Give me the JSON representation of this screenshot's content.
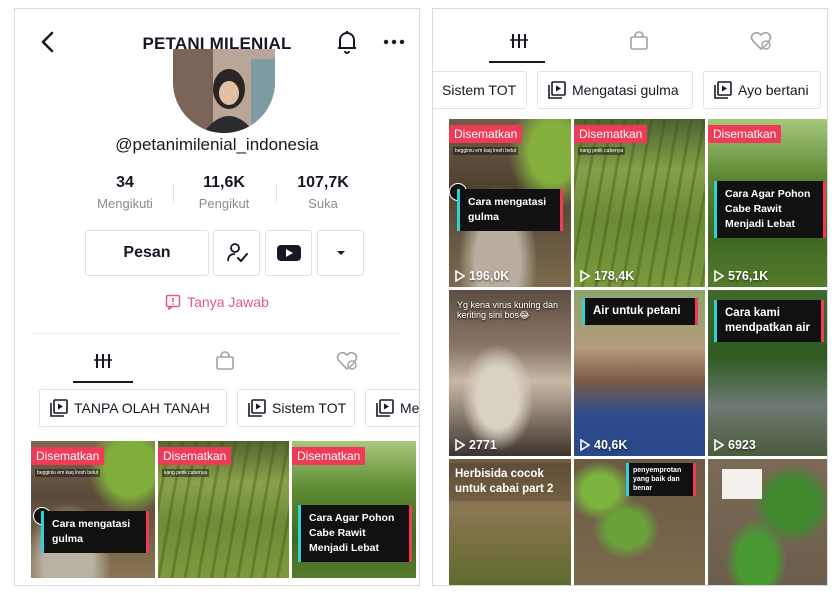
{
  "header": {
    "title": "PETANI MILENIAL"
  },
  "profile": {
    "username": "@petanimilenial_indonesia",
    "stats": [
      {
        "value": "34",
        "label": "Mengikuti"
      },
      {
        "value": "11,6K",
        "label": "Pengikut"
      },
      {
        "value": "107,7K",
        "label": "Suka"
      }
    ],
    "message_label": "Pesan",
    "qa_label": "Tanya Jawab"
  },
  "playlists_left": [
    "TANPA OLAH TANAH",
    "Sistem TOT",
    "Me"
  ],
  "playlists_right": [
    "Sistem TOT",
    "Mengatasi gulma",
    "Ayo bertani"
  ],
  "pinned_label": "Disematkan",
  "videos": [
    {
      "caption": "Cara mengatasi gulma",
      "note": "begginiu em kaq lresh belut",
      "views": "196,0K"
    },
    {
      "caption": "",
      "note": "kang petik cabenya",
      "views": "178,4K"
    },
    {
      "caption": "Cara Agar Pohon Cabe Rawit Menjadi Lebat",
      "note": "",
      "views": "576,1K"
    },
    {
      "caption": "Yg kena virus kuning dan keriting sini bos😂",
      "note": "",
      "views": "2771"
    },
    {
      "caption": "Air untuk petani",
      "note": "",
      "views": "40,6K"
    },
    {
      "caption": "Cara kami mendpatkan air",
      "note": "",
      "views": "6923"
    },
    {
      "caption": "Herbisida cocok untuk cabai part 2",
      "note": "",
      "views": ""
    },
    {
      "caption": "penyemprotan yang baik dan benar",
      "note": "",
      "views": ""
    },
    {
      "caption": "",
      "note": "",
      "views": ""
    }
  ],
  "colors": {
    "accent_pink": "#ef3b57",
    "qa_pink": "#e45b7e",
    "cyan": "#2fd0d6"
  }
}
